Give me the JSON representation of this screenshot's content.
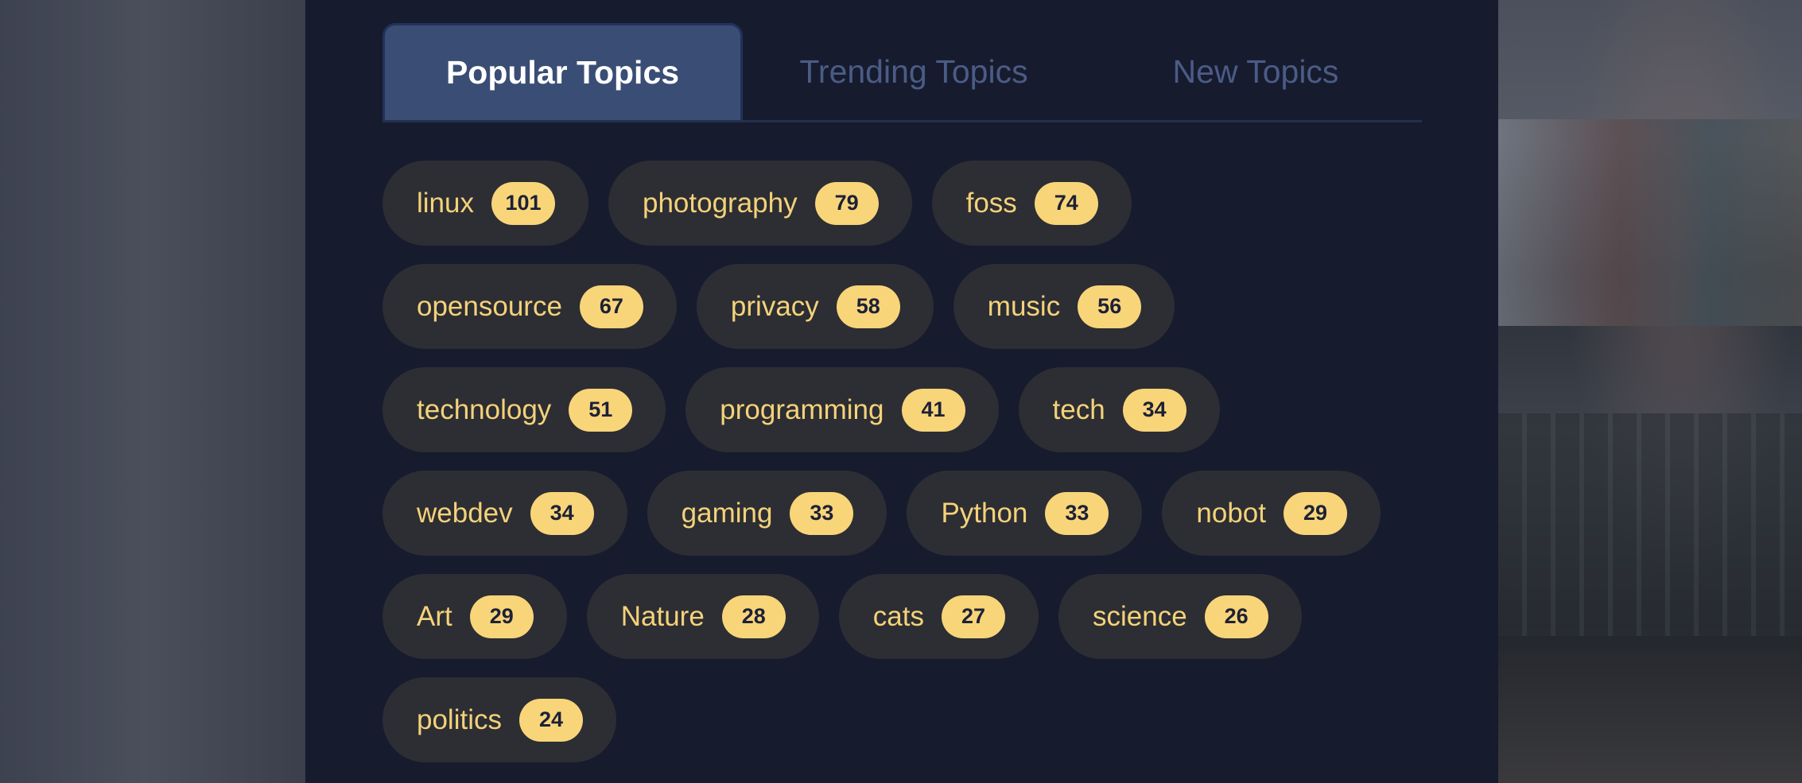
{
  "tabs": [
    {
      "label": "Popular Topics",
      "active": true
    },
    {
      "label": "Trending Topics",
      "active": false
    },
    {
      "label": "New Topics",
      "active": false
    }
  ],
  "topics": [
    {
      "name": "linux",
      "count": "101"
    },
    {
      "name": "photography",
      "count": "79"
    },
    {
      "name": "foss",
      "count": "74"
    },
    {
      "name": "opensource",
      "count": "67"
    },
    {
      "name": "privacy",
      "count": "58"
    },
    {
      "name": "music",
      "count": "56"
    },
    {
      "name": "technology",
      "count": "51"
    },
    {
      "name": "programming",
      "count": "41"
    },
    {
      "name": "tech",
      "count": "34"
    },
    {
      "name": "webdev",
      "count": "34"
    },
    {
      "name": "gaming",
      "count": "33"
    },
    {
      "name": "Python",
      "count": "33"
    },
    {
      "name": "nobot",
      "count": "29"
    },
    {
      "name": "Art",
      "count": "29"
    },
    {
      "name": "Nature",
      "count": "28"
    },
    {
      "name": "cats",
      "count": "27"
    },
    {
      "name": "science",
      "count": "26"
    },
    {
      "name": "politics",
      "count": "24"
    }
  ],
  "colors": {
    "panel": "#171b2e",
    "active_tab": "#3a4d74",
    "pill": "#2d2e33",
    "accent": "#f9d57a"
  }
}
